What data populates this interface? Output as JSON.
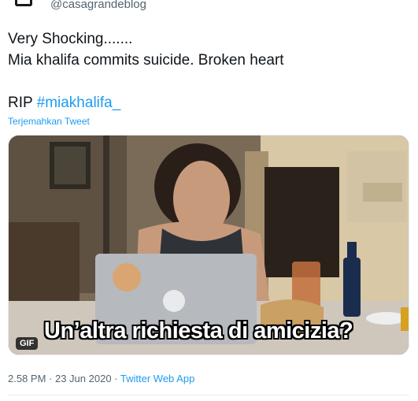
{
  "author": {
    "handle": "@casagrandeblog"
  },
  "tweet": {
    "line1": "Very Shocking.......",
    "line2": "Mia khalifa commits suicide. Broken heart",
    "rip": "RIP",
    "hashtag": "#miakhalifa_",
    "translate_label": "Terjemahkan Tweet"
  },
  "media": {
    "badge": "GIF",
    "caption": "Un’altra richiesta di amicizia?"
  },
  "meta": {
    "time": "2.58 PM",
    "separator1": " · ",
    "date": "23 Jun 2020",
    "separator2": " · ",
    "source": "Twitter Web App"
  },
  "colors": {
    "link": "#1d9bf0",
    "text": "#0f1419",
    "muted": "#536471"
  }
}
